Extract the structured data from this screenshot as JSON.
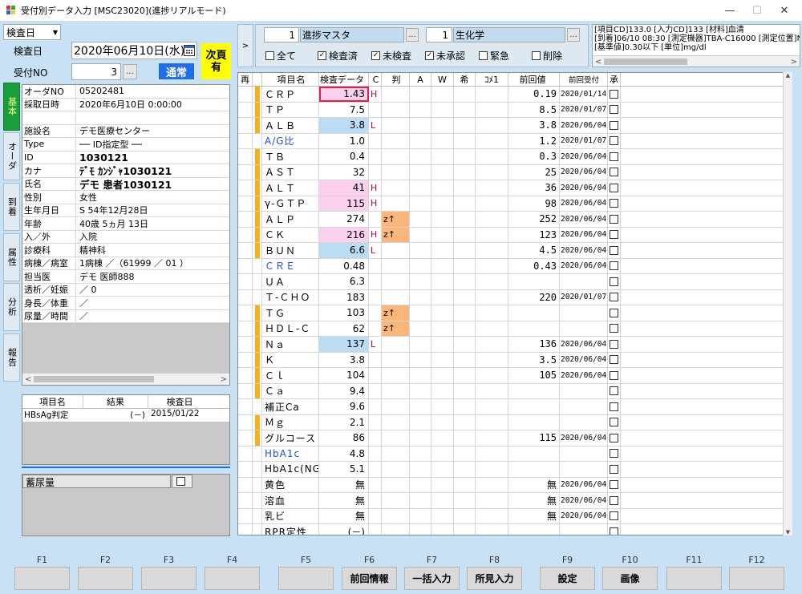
{
  "window": {
    "title": "受付別データ入力 [MSC23020](進捗リアルモード)",
    "min": "—",
    "max": "☐",
    "close": "✕"
  },
  "top": {
    "date_type": "検査日",
    "date_label": "検査日",
    "date_value": "2020年06月10日(水)",
    "recv_label": "受付NO",
    "recv_value": "3",
    "dots": "...",
    "status_badge": "通常",
    "next_badge": "次頁有",
    "master_no": "1",
    "master_name": "進捗マスタ",
    "cat_no": "1",
    "cat_name": "生化学"
  },
  "filters": [
    {
      "label": "全て",
      "checked": false
    },
    {
      "label": "検査済",
      "checked": true
    },
    {
      "label": "未検査",
      "checked": true
    },
    {
      "label": "未承認",
      "checked": true
    },
    {
      "label": "緊急",
      "checked": false
    },
    {
      "label": "削除",
      "checked": false
    }
  ],
  "info": {
    "line1": "[項目CD]133.0 [入力CD]133 [材料]血清",
    "line2": "[到着]06/10 08:30 [測定機器]TBA-C16000 [測定位置]N6",
    "line3": "[基準値]0.30以下 [単位]mg/dl"
  },
  "tabs": [
    "基本",
    "オーダ",
    "到着",
    "属性",
    "分析",
    "報告"
  ],
  "patient": [
    {
      "k": "オーダNO",
      "v": "05202481"
    },
    {
      "k": "採取日時",
      "v": "2020年6月10日 0:00:00"
    },
    {
      "k": "",
      "v": ""
    },
    {
      "k": "施設名",
      "v": "デモ医療センター"
    },
    {
      "k": "Type",
      "v": "── ID指定型 ──"
    },
    {
      "k": "ID",
      "v": "1030121"
    },
    {
      "k": "カナ",
      "v": "ﾃﾞﾓ ｶﾝｼﾞｬ1030121"
    },
    {
      "k": "氏名",
      "v": "デモ 患者1030121"
    },
    {
      "k": "性別",
      "v": "女性"
    },
    {
      "k": "生年月日",
      "v": "S 54年12月28日"
    },
    {
      "k": "年齢",
      "v": "40歳 5ヵ月 13日"
    },
    {
      "k": "入／外",
      "v": "入院"
    },
    {
      "k": "診療科",
      "v": "精神科"
    },
    {
      "k": "病棟／病室",
      "v": "1病棟 ／（61999 ／ 01 ）"
    },
    {
      "k": "担当医",
      "v": "デモ 医師888"
    },
    {
      "k": "透析／妊娠",
      "v": "／ 0"
    },
    {
      "k": "身長／体重",
      "v": "／"
    },
    {
      "k": "尿量／時間",
      "v": "／"
    }
  ],
  "prior": {
    "headers": [
      "項目名",
      "結果",
      "検査日"
    ],
    "row": {
      "name": "HBsAg判定",
      "result": "(－)",
      "date": "2015/01/22"
    }
  },
  "urine": {
    "label": "蓄尿量"
  },
  "grid": {
    "headers": [
      "再",
      "項目名",
      "検査データ",
      "C",
      "判",
      "A",
      "W",
      "希",
      "ｺﾒ1",
      "前回値",
      "前回受付",
      "承"
    ],
    "rows": [
      {
        "name": "ＣＲＰ",
        "val": "1.43",
        "c": "H",
        "han": "",
        "prev": "0.19",
        "pdate": "2020/01/14[",
        "bar": true,
        "hl": "pink",
        "sel": true
      },
      {
        "name": "ＴＰ",
        "val": "7.5",
        "c": "",
        "han": "",
        "prev": "8.5",
        "pdate": "2020/01/07[",
        "bar": true,
        "hl": ""
      },
      {
        "name": "ＡＬＢ",
        "val": "3.8",
        "c": "L",
        "han": "",
        "prev": "3.8",
        "pdate": "2020/06/04[",
        "bar": true,
        "hl": "blue"
      },
      {
        "name": "A/G比",
        "val": "1.0",
        "c": "",
        "han": "",
        "prev": "1.2",
        "pdate": "2020/01/07[",
        "bar": false,
        "hl": "",
        "blue": true
      },
      {
        "name": "ＴＢ",
        "val": "0.4",
        "c": "",
        "han": "",
        "prev": "0.3",
        "pdate": "2020/06/04[",
        "bar": true,
        "hl": ""
      },
      {
        "name": "ＡＳＴ",
        "val": "32",
        "c": "",
        "han": "",
        "prev": "25",
        "pdate": "2020/06/04[",
        "bar": true,
        "hl": ""
      },
      {
        "name": "ＡＬＴ",
        "val": "41",
        "c": "H",
        "han": "",
        "prev": "36",
        "pdate": "2020/06/04[",
        "bar": true,
        "hl": "pink"
      },
      {
        "name": "γ-ＧＴＰ",
        "val": "115",
        "c": "H",
        "han": "",
        "prev": "98",
        "pdate": "2020/06/04[",
        "bar": true,
        "hl": "pink"
      },
      {
        "name": "ＡＬＰ",
        "val": "274",
        "c": "",
        "han": "z↑",
        "prev": "252",
        "pdate": "2020/06/04[",
        "bar": true,
        "hl": ""
      },
      {
        "name": "ＣＫ",
        "val": "216",
        "c": "H",
        "han": "z↑",
        "prev": "123",
        "pdate": "2020/06/04[",
        "bar": true,
        "hl": "pink"
      },
      {
        "name": "ＢＵＮ",
        "val": "6.6",
        "c": "L",
        "han": "",
        "prev": "4.5",
        "pdate": "2020/06/04[",
        "bar": true,
        "hl": "blue"
      },
      {
        "name": "ＣＲＥ",
        "val": "0.48",
        "c": "",
        "han": "",
        "prev": "0.43",
        "pdate": "2020/06/04[",
        "bar": false,
        "hl": "",
        "blue": true
      },
      {
        "name": "ＵＡ",
        "val": "6.3",
        "c": "",
        "han": "",
        "prev": "",
        "pdate": "",
        "bar": false,
        "hl": ""
      },
      {
        "name": "Ｔ-ＣＨＯ",
        "val": "183",
        "c": "",
        "han": "",
        "prev": "220",
        "pdate": "2020/01/07[",
        "bar": false,
        "hl": ""
      },
      {
        "name": "ＴＧ",
        "val": "103",
        "c": "",
        "han": "z↑",
        "prev": "",
        "pdate": "",
        "bar": true,
        "hl": ""
      },
      {
        "name": "ＨＤＬ-Ｃ",
        "val": "62",
        "c": "",
        "han": "z↑",
        "prev": "",
        "pdate": "",
        "bar": true,
        "hl": ""
      },
      {
        "name": "Ｎａ",
        "val": "137",
        "c": "L",
        "han": "",
        "prev": "136",
        "pdate": "2020/06/04[",
        "bar": true,
        "hl": "blue"
      },
      {
        "name": "Ｋ",
        "val": "3.8",
        "c": "",
        "han": "",
        "prev": "3.5",
        "pdate": "2020/06/04[",
        "bar": true,
        "hl": ""
      },
      {
        "name": "Ｃｌ",
        "val": "104",
        "c": "",
        "han": "",
        "prev": "105",
        "pdate": "2020/06/04[",
        "bar": true,
        "hl": ""
      },
      {
        "name": "Ｃａ",
        "val": "9.4",
        "c": "",
        "han": "",
        "prev": "",
        "pdate": "",
        "bar": true,
        "hl": ""
      },
      {
        "name": "補正Ca",
        "val": "9.6",
        "c": "",
        "han": "",
        "prev": "",
        "pdate": "",
        "bar": false,
        "hl": ""
      },
      {
        "name": "Ｍｇ",
        "val": "2.1",
        "c": "",
        "han": "",
        "prev": "",
        "pdate": "",
        "bar": true,
        "hl": ""
      },
      {
        "name": "グルコース",
        "val": "86",
        "c": "",
        "han": "",
        "prev": "115",
        "pdate": "2020/06/04[",
        "bar": true,
        "hl": ""
      },
      {
        "name": "HbA1c",
        "val": "4.8",
        "c": "",
        "han": "",
        "prev": "",
        "pdate": "",
        "bar": false,
        "hl": "",
        "blue": true
      },
      {
        "name": "HbA1c(NGSP",
        "val": "5.1",
        "c": "",
        "han": "",
        "prev": "",
        "pdate": "",
        "bar": false,
        "hl": ""
      },
      {
        "name": "黄色",
        "val": "無",
        "c": "",
        "han": "",
        "prev": "無",
        "pdate": "2020/06/04[",
        "bar": false,
        "hl": ""
      },
      {
        "name": "溶血",
        "val": "無",
        "c": "",
        "han": "",
        "prev": "無",
        "pdate": "2020/06/04[",
        "bar": false,
        "hl": ""
      },
      {
        "name": "乳ビ",
        "val": "無",
        "c": "",
        "han": "",
        "prev": "無",
        "pdate": "2020/06/04[",
        "bar": false,
        "hl": ""
      },
      {
        "name": "RPR定性",
        "val": "(－)",
        "c": "",
        "han": "",
        "prev": "",
        "pdate": "",
        "bar": false,
        "hl": ""
      }
    ]
  },
  "fkeys": [
    {
      "key": "F1",
      "label": ""
    },
    {
      "key": "F2",
      "label": ""
    },
    {
      "key": "F3",
      "label": ""
    },
    {
      "key": "F4",
      "label": ""
    },
    {
      "key": "F5",
      "label": ""
    },
    {
      "key": "F6",
      "label": "前回情報"
    },
    {
      "key": "F7",
      "label": "一括入力"
    },
    {
      "key": "F8",
      "label": "所見入力"
    },
    {
      "key": "F9",
      "label": "設定"
    },
    {
      "key": "F10",
      "label": "画像"
    },
    {
      "key": "F11",
      "label": ""
    },
    {
      "key": "F12",
      "label": ""
    }
  ],
  "colors": {
    "pink": "#fbd0ef",
    "blue": "#bcdcf4",
    "orange": "#fbb77a",
    "bar": "#f6b11a",
    "accent": "#1e6ee8",
    "badge": "#ffff00"
  }
}
